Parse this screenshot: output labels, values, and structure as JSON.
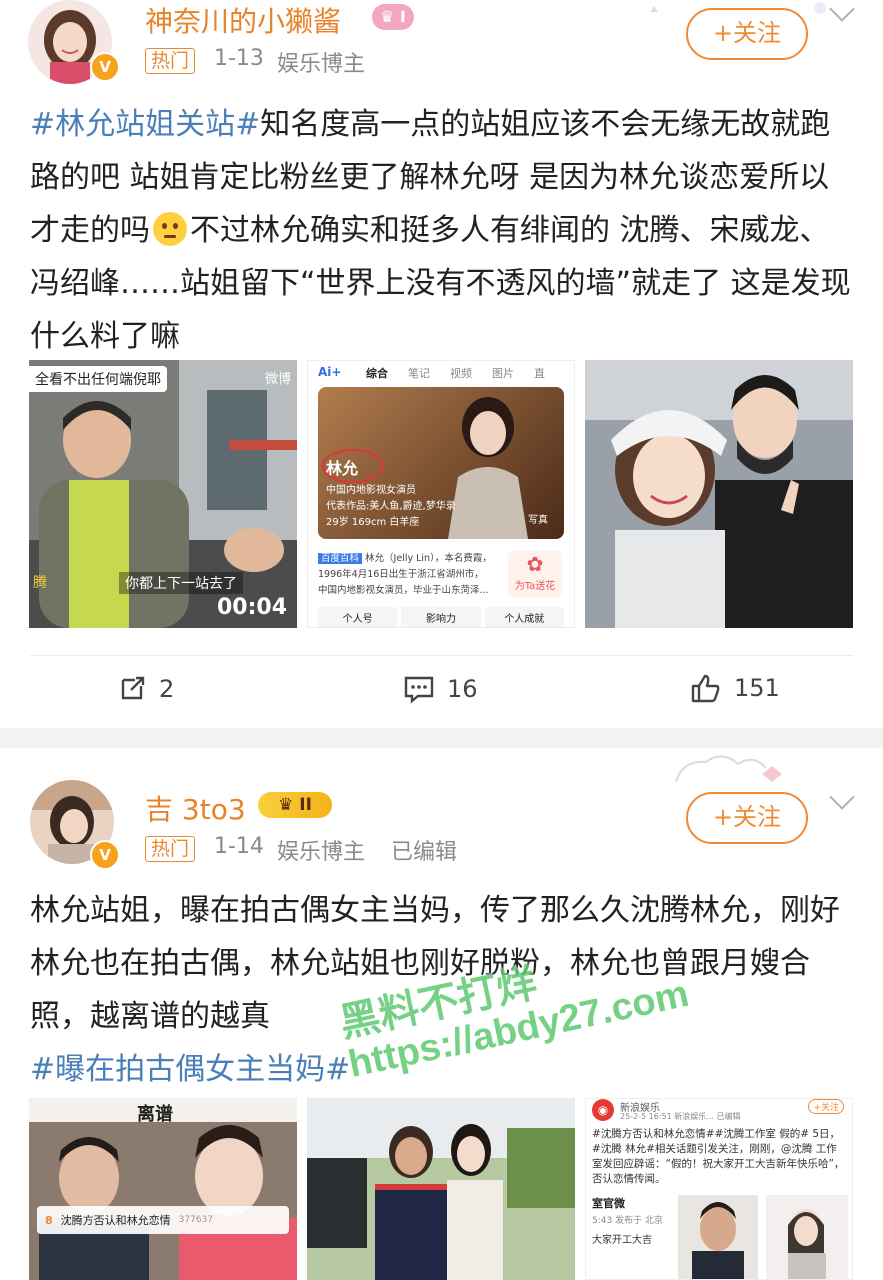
{
  "colors": {
    "accent": "#f08a33",
    "hashtag": "#4a7fb8",
    "watermark": "#5ec96f"
  },
  "post1": {
    "username": "神奈川的小獭酱",
    "hot_tag": "热门",
    "date": "1-13",
    "category": "娱乐博主",
    "follow_label": "+关注",
    "hashtag": "#林允站姐关站#",
    "text": "知名度高一点的站姐应该不会无缘无故就跑路的吧 站姐肯定比粉丝更了解林允呀 是因为林允谈恋爱所以才走的吗",
    "text2": "不过林允确实和挺多人有绯闻的 沈腾、宋威龙、冯绍峰……站姐留下“世界上没有不透风的墙”就走了 这是发现什么料了嘛",
    "emoji": "thinking-face-icon",
    "image1": {
      "caption_top": "全看不出任何端倪耶",
      "logo": "微博",
      "subtitle": "你都上下一站去了",
      "duration": "00:04",
      "side_label": "腾"
    },
    "image2": {
      "brand": "Ai+",
      "tabs": [
        "综合",
        "笔记",
        "视频",
        "图片",
        "直"
      ],
      "name": "林允",
      "desc1": "中国内地影视女演员",
      "desc2": "代表作品:美人鱼,爵迹,梦华录",
      "desc3": "29岁  169cm  白羊座",
      "photo_label": "写真",
      "baike_tag": "百度百科",
      "bio1": "林允（Jelly Lin），本名费霞，",
      "bio2": "1996年4月16日出生于浙江省湖州市，",
      "bio3": "中国内地影视女演员，毕业于山东菏泽...",
      "flower": "为Ta送花",
      "btns": [
        "个人号",
        "影响力",
        "个人成就"
      ]
    },
    "actions": {
      "repost": "2",
      "comment": "16",
      "like": "151"
    }
  },
  "post2": {
    "username": "吉 3to3",
    "level": "II",
    "hot_tag": "热门",
    "date": "1-14",
    "category": "娱乐博主",
    "edited": "已编辑",
    "follow_label": "+关注",
    "text": "林允站姐，曝在拍古偶女主当妈，传了那么久沈腾林允，刚好林允也在拍古偶，林允站姐也刚好脱粉，林允也曾跟月嫂合照，越离谱的越真",
    "hashtag": "#曝在拍古偶女主当妈#",
    "image1": {
      "top_text": "离谱",
      "search_index": "8",
      "search_text": "沈腾方否认和林允恋情",
      "search_count": "377637"
    },
    "image3": {
      "source": "新浪娱乐",
      "follow": "+关注",
      "meta": "25-2-5 16:51  新浪娱乐... 已编辑",
      "body": "#沈腾方否认和林允恋情##沈腾工作室 假的# 5日，#沈腾 林允#相关话题引发关注，刚刚，@沈腾 工作室发回应辟谣：“假的！祝大家开工大吉新年快乐哈”，否认恋情传闻。",
      "footer_name": "室官微",
      "footer_meta": "5:43  发布于 北京",
      "footer_text": "大家开工大吉"
    }
  },
  "watermark": {
    "line1": "黑料不打烊",
    "line2": "https://abdy27.com"
  }
}
